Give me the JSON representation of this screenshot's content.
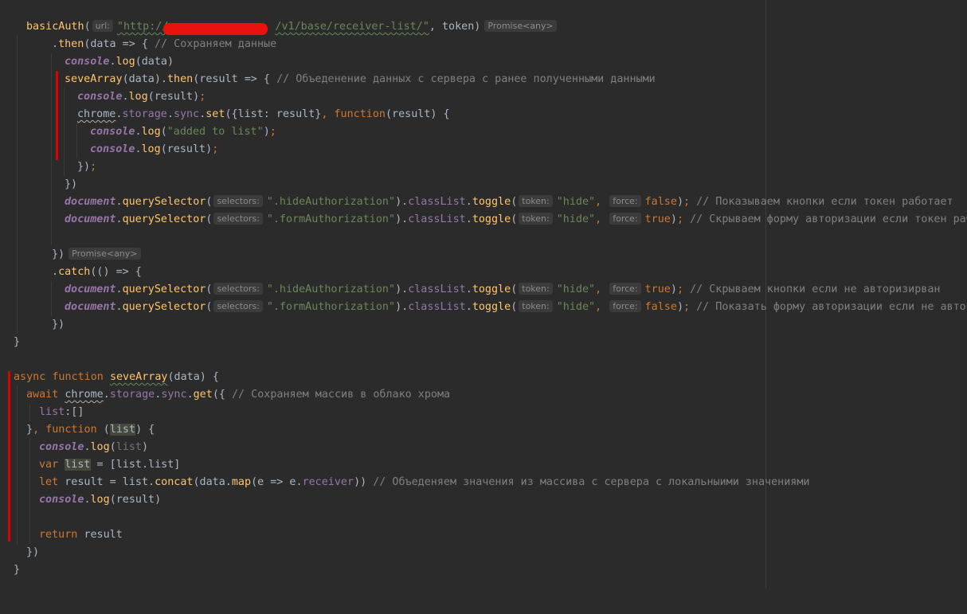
{
  "hints": {
    "url": "url:",
    "token": "token:",
    "force": "force:",
    "selectors": "selectors:",
    "promise": "Promise<any>"
  },
  "lines": {
    "l1": {
      "basicAuth": "basicAuth",
      "p1": "(",
      "url_a": "\"http://",
      "url_b": "/v1/base/receiver-list/\"",
      "p2": ", token)"
    },
    "l2": {
      "a": ".",
      "then": "then",
      "b": "(data => { ",
      "c": "// Сохраняем данные"
    },
    "l3": {
      "console": "console",
      "dot": ".",
      "log": "log",
      "b": "(data)"
    },
    "l4": {
      "seve": "seveArray",
      "a": "(data).",
      "then": "then",
      "b": "(result => { ",
      "c": "// Объеденение данных с сервера с ранее полученными данными"
    },
    "l5": {
      "console": "console",
      "dot": ".",
      "log": "log",
      "b": "(result)",
      "semi": ";"
    },
    "l6": {
      "chrome": "chrome",
      "d1": ".",
      "storage": "storage",
      "d2": ".",
      "sync": "sync",
      "d3": ".",
      "set": "set",
      "b": "({list: result}",
      "comma": ", ",
      "function": "function",
      "c": "(result) {"
    },
    "l7": {
      "console": "console",
      "dot": ".",
      "log": "log",
      "a": "(",
      "str": "\"added to list\"",
      "b": ")",
      "semi": ";"
    },
    "l8": {
      "console": "console",
      "dot": ".",
      "log": "log",
      "b": "(result)",
      "semi": ";"
    },
    "l9": {
      "a": "})",
      "semi": ";"
    },
    "l10": {
      "a": "})"
    },
    "l11": {
      "document": "document",
      "d1": ".",
      "qs": "querySelector",
      "a": "(",
      "sel": "\".hideAuthorization\"",
      "b": ").",
      "classList": "classList",
      "d2": ".",
      "toggle": "toggle",
      "c": "(",
      "hide": "\"hide\"",
      "comma": ", ",
      "val": "false",
      "d": ")",
      "semi": "; ",
      "cm": "// Показываем кнопки если токен работает"
    },
    "l12": {
      "document": "document",
      "d1": ".",
      "qs": "querySelector",
      "a": "(",
      "sel": "\".formAuthorization\"",
      "b": ").",
      "classList": "classList",
      "d2": ".",
      "toggle": "toggle",
      "c": "(",
      "hide": "\"hide\"",
      "comma": ", ",
      "val": "true",
      "d": ")",
      "semi": "; ",
      "cm": "// Скрываем форму авторизации если токен работ"
    },
    "l14": {
      "a": "})"
    },
    "l15": {
      "a": ".",
      "catch": "catch",
      "b": "(() => {"
    },
    "l16": {
      "document": "document",
      "d1": ".",
      "qs": "querySelector",
      "a": "(",
      "sel": "\".hideAuthorization\"",
      "b": ").",
      "classList": "classList",
      "d2": ".",
      "toggle": "toggle",
      "c": "(",
      "hide": "\"hide\"",
      "comma": ", ",
      "val": "true",
      "d": ")",
      "semi": "; ",
      "cm": "// Скрываем кнопки если не авторизирван"
    },
    "l17": {
      "document": "document",
      "d1": ".",
      "qs": "querySelector",
      "a": "(",
      "sel": "\".formAuthorization\"",
      "b": ").",
      "classList": "classList",
      "d2": ".",
      "toggle": "toggle",
      "c": "(",
      "hide": "\"hide\"",
      "comma": ", ",
      "val": "false",
      "d": ")",
      "semi": "; ",
      "cm": "// Показать форму авторизации если не авториз"
    },
    "l18": {
      "a": "})"
    },
    "l19": {
      "a": "}"
    },
    "l21": {
      "async": "async ",
      "function": "function ",
      "name": "seveArray",
      "b": "(data) {"
    },
    "l22": {
      "await": "await ",
      "chrome": "chrome",
      "d1": ".",
      "storage": "storage",
      "d2": ".",
      "sync": "sync",
      "d3": ".",
      "get": "get",
      "b": "({ ",
      "cm": "// Сохраняем массив в облако хрома"
    },
    "l23": {
      "prop": "list",
      "b": ":[]"
    },
    "l24": {
      "a": "}",
      "comma": ", ",
      "function": "function ",
      "b": "(",
      "param": "list",
      "c": ") {"
    },
    "l25": {
      "console": "console",
      "dot": ".",
      "log": "log",
      "a": "(",
      "arg": "list",
      "b": ")"
    },
    "l26": {
      "var": "var ",
      "name": "list",
      "b": " = [list.list]"
    },
    "l27": {
      "let": "let ",
      "a": "result = list.",
      "concat": "concat",
      "b": "(data.",
      "map": "map",
      "c": "(e => e.",
      "receiver": "receiver",
      "d": ")) ",
      "cm": "// Объеденяем значения из массива с сервера с локальныими значениями"
    },
    "l28": {
      "console": "console",
      "dot": ".",
      "log": "log",
      "b": "(result)"
    },
    "l30": {
      "return": "return ",
      "b": "result"
    },
    "l31": {
      "a": "})"
    },
    "l32": {
      "a": "}"
    }
  }
}
